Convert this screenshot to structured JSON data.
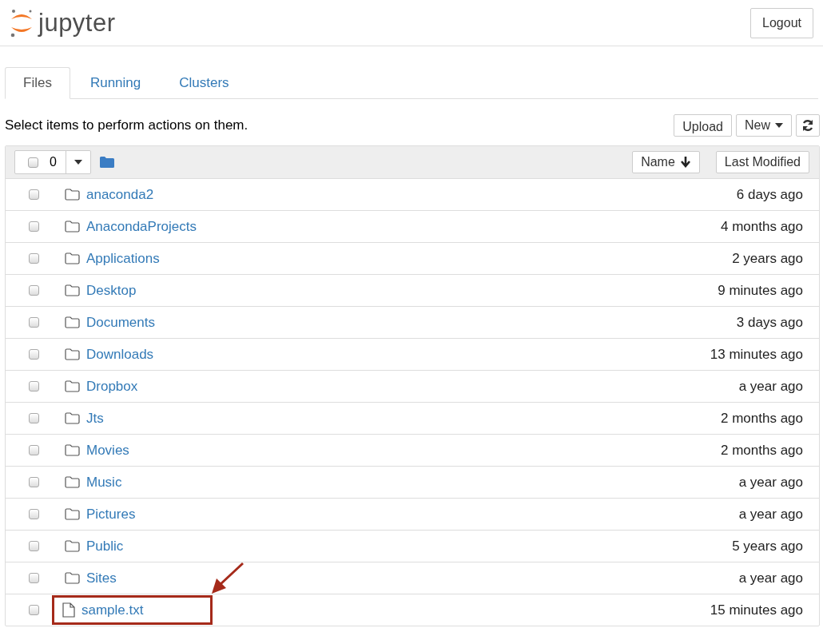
{
  "header": {
    "logo_text": "jupyter",
    "logout_button": "Logout"
  },
  "tabs": [
    {
      "label": "Files",
      "selected": true
    },
    {
      "label": "Running",
      "selected": false
    },
    {
      "label": "Clusters",
      "selected": false
    }
  ],
  "instructions": "Select items to perform actions on them.",
  "actions": {
    "upload": "Upload",
    "new": "New"
  },
  "list_header": {
    "selected_count": "0",
    "select_all_checked": false,
    "sort_name": "Name",
    "sort_modified": "Last Modified"
  },
  "items": [
    {
      "kind": "folder",
      "name": "anaconda2",
      "modified": "6 days ago",
      "checked": false,
      "highlighted": false
    },
    {
      "kind": "folder",
      "name": "AnacondaProjects",
      "modified": "4 months ago",
      "checked": false,
      "highlighted": false
    },
    {
      "kind": "folder",
      "name": "Applications",
      "modified": "2 years ago",
      "checked": false,
      "highlighted": false
    },
    {
      "kind": "folder",
      "name": "Desktop",
      "modified": "9 minutes ago",
      "checked": false,
      "highlighted": false
    },
    {
      "kind": "folder",
      "name": "Documents",
      "modified": "3 days ago",
      "checked": false,
      "highlighted": false
    },
    {
      "kind": "folder",
      "name": "Downloads",
      "modified": "13 minutes ago",
      "checked": false,
      "highlighted": false
    },
    {
      "kind": "folder",
      "name": "Dropbox",
      "modified": "a year ago",
      "checked": false,
      "highlighted": false
    },
    {
      "kind": "folder",
      "name": "Jts",
      "modified": "2 months ago",
      "checked": false,
      "highlighted": false
    },
    {
      "kind": "folder",
      "name": "Movies",
      "modified": "2 months ago",
      "checked": false,
      "highlighted": false
    },
    {
      "kind": "folder",
      "name": "Music",
      "modified": "a year ago",
      "checked": false,
      "highlighted": false
    },
    {
      "kind": "folder",
      "name": "Pictures",
      "modified": "a year ago",
      "checked": false,
      "highlighted": false
    },
    {
      "kind": "folder",
      "name": "Public",
      "modified": "5 years ago",
      "checked": false,
      "highlighted": false
    },
    {
      "kind": "folder",
      "name": "Sites",
      "modified": "a year ago",
      "checked": false,
      "highlighted": false
    },
    {
      "kind": "file",
      "name": "sample.txt",
      "modified": "15 minutes ago",
      "checked": false,
      "highlighted": true
    }
  ]
}
